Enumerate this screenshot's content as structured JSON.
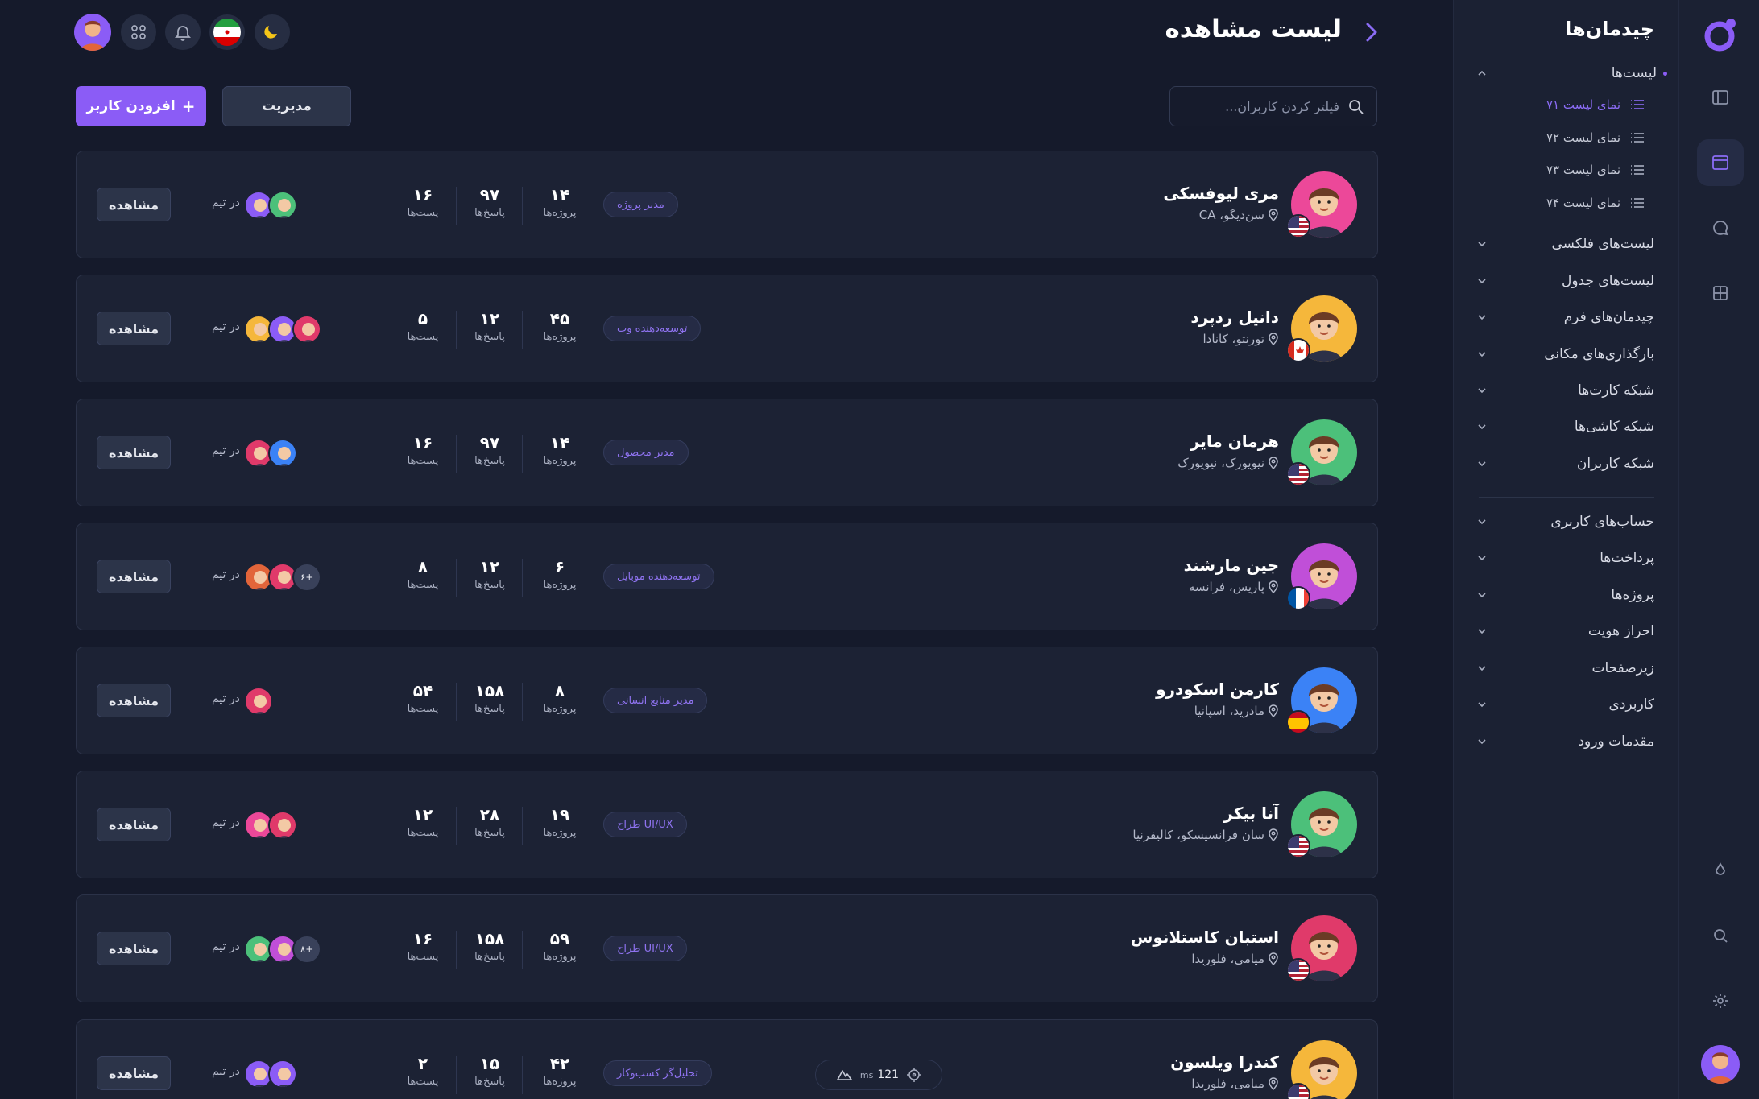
{
  "header": {
    "title": "لیست مشاهده"
  },
  "toolbar": {
    "search_placeholder": "فیلتر کردن کاربران...",
    "manage_label": "مدیریت",
    "add_label": "افزودن کاربر",
    "add_prefix": "+"
  },
  "sidebar": {
    "title": "چیدمان‌ها",
    "lists_label": "لیست‌ها",
    "sub_items": [
      {
        "label": "نمای لیست ۷۱"
      },
      {
        "label": "نمای لیست ۷۲"
      },
      {
        "label": "نمای لیست ۷۳"
      },
      {
        "label": "نمای لیست ۷۴"
      }
    ],
    "groups": [
      {
        "label": "لیست‌های فلکسی"
      },
      {
        "label": "لیست‌های جدول"
      },
      {
        "label": "چیدمان‌های فرم"
      },
      {
        "label": "بارگذاری‌های مکانی"
      },
      {
        "label": "شبکه کارت‌ها"
      },
      {
        "label": "شبکه کاشی‌ها"
      },
      {
        "label": "شبکه کاربران"
      }
    ],
    "groups2": [
      {
        "label": "حساب‌های کاربری"
      },
      {
        "label": "پرداخت‌ها"
      },
      {
        "label": "پروژه‌ها"
      },
      {
        "label": "احراز هویت"
      },
      {
        "label": "زیرصفحات"
      },
      {
        "label": "کاربردی"
      },
      {
        "label": "مقدمات ورود"
      }
    ]
  },
  "labels": {
    "projects": "پروژه‌ها",
    "replies": "پاسخ‌ها",
    "posts": "پست‌ها",
    "in_team": "در تیم",
    "view": "مشاهده"
  },
  "users": [
    {
      "name": "مری لیوفسکی",
      "location": "سن‌دیگو، CA",
      "role": "مدیر پروژه",
      "projects": "۱۴",
      "replies": "۹۷",
      "posts": "۱۶",
      "flag": "us",
      "avatar_bg": "#ec4899",
      "team_more": ""
    },
    {
      "name": "دانیل ردپرد",
      "location": "تورنتو، کانادا",
      "role": "توسعه‌دهنده وب",
      "projects": "۴۵",
      "replies": "۱۲",
      "posts": "۵",
      "flag": "ca",
      "avatar_bg": "#f5b73b",
      "team_more": ""
    },
    {
      "name": "هرمان مایر",
      "location": "نیویورک، نیویورک",
      "role": "مدیر محصول",
      "projects": "۱۴",
      "replies": "۹۷",
      "posts": "۱۶",
      "flag": "us",
      "avatar_bg": "#4cc07a",
      "team_more": ""
    },
    {
      "name": "جین مارشند",
      "location": "پاریس، فرانسه",
      "role": "توسعه‌دهنده موبایل",
      "projects": "۶",
      "replies": "۱۲",
      "posts": "۸",
      "flag": "fr",
      "avatar_bg": "#c04fd8",
      "team_more": "۶+"
    },
    {
      "name": "کارمن اسکودرو",
      "location": "مادرید، اسپانیا",
      "role": "مدیر منابع انسانی",
      "projects": "۸",
      "replies": "۱۵۸",
      "posts": "۵۴",
      "flag": "es",
      "avatar_bg": "#3b82f6",
      "team_more": ""
    },
    {
      "name": "آنا بیکر",
      "location": "سان فرانسیسکو، کالیفرنیا",
      "role": "طراح UI/UX",
      "projects": "۱۹",
      "replies": "۲۸",
      "posts": "۱۲",
      "flag": "us",
      "avatar_bg": "#4cc07a",
      "team_more": ""
    },
    {
      "name": "استبان کاستلانوس",
      "location": "میامی، فلوریدا",
      "role": "طراح UI/UX",
      "projects": "۵۹",
      "replies": "۱۵۸",
      "posts": "۱۶",
      "flag": "us",
      "avatar_bg": "#e03a6a",
      "team_more": "۸+"
    },
    {
      "name": "کندرا ویلسون",
      "location": "میامی، فلوریدا",
      "role": "تحلیل‌گر کسب‌وکار",
      "projects": "۴۲",
      "replies": "۱۵",
      "posts": "۲",
      "flag": "us",
      "avatar_bg": "#f5b73b",
      "team_more": ""
    }
  ],
  "perf": {
    "value": "121",
    "unit": "ms"
  }
}
